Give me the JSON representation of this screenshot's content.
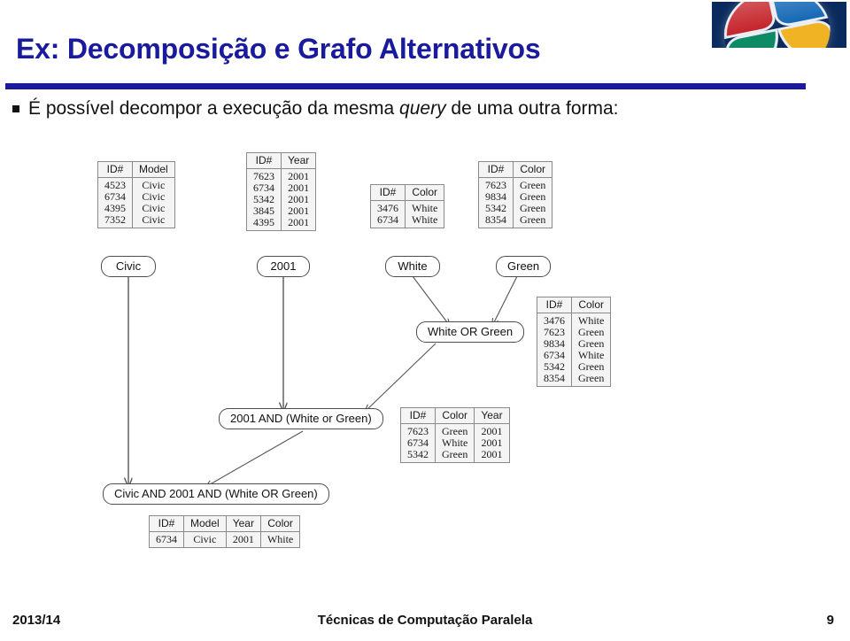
{
  "slide": {
    "title": "Ex: Decomposição e Grafo Alternativos",
    "bullet_text_before": "É possível decompor a execução da mesma ",
    "bullet_emphasis": "query",
    "bullet_text_after": " de uma outra forma:",
    "logo_name": "windows-flag-logo",
    "accent_color": "#1a1a9c"
  },
  "diagram": {
    "tables": [
      {
        "name": "table-model-civic",
        "headers": [
          "ID#",
          "Model"
        ],
        "rows": [
          [
            "4523",
            "Civic"
          ],
          [
            "6734",
            "Civic"
          ],
          [
            "4395",
            "Civic"
          ],
          [
            "7352",
            "Civic"
          ]
        ]
      },
      {
        "name": "table-year-2001",
        "headers": [
          "ID#",
          "Year"
        ],
        "rows": [
          [
            "7623",
            "2001"
          ],
          [
            "6734",
            "2001"
          ],
          [
            "5342",
            "2001"
          ],
          [
            "3845",
            "2001"
          ],
          [
            "4395",
            "2001"
          ]
        ]
      },
      {
        "name": "table-color-white",
        "headers": [
          "ID#",
          "Color"
        ],
        "rows": [
          [
            "3476",
            "White"
          ],
          [
            "6734",
            "White"
          ]
        ]
      },
      {
        "name": "table-color-green",
        "headers": [
          "ID#",
          "Color"
        ],
        "rows": [
          [
            "7623",
            "Green"
          ],
          [
            "9834",
            "Green"
          ],
          [
            "5342",
            "Green"
          ],
          [
            "8354",
            "Green"
          ]
        ]
      },
      {
        "name": "table-white-or-green",
        "headers": [
          "ID#",
          "Color"
        ],
        "rows": [
          [
            "3476",
            "White"
          ],
          [
            "7623",
            "Green"
          ],
          [
            "9834",
            "Green"
          ],
          [
            "6734",
            "White"
          ],
          [
            "5342",
            "Green"
          ],
          [
            "8354",
            "Green"
          ]
        ]
      },
      {
        "name": "table-2001-and-white-or-green",
        "headers": [
          "ID#",
          "Color",
          "Year"
        ],
        "rows": [
          [
            "7623",
            "Green",
            "2001"
          ],
          [
            "6734",
            "White",
            "2001"
          ],
          [
            "5342",
            "Green",
            "2001"
          ]
        ]
      },
      {
        "name": "table-final-result",
        "headers": [
          "ID#",
          "Model",
          "Year",
          "Color"
        ],
        "rows": [
          [
            "6734",
            "Civic",
            "2001",
            "White"
          ]
        ]
      }
    ],
    "nodes": [
      {
        "name": "node-civic",
        "label": "Civic"
      },
      {
        "name": "node-2001",
        "label": "2001"
      },
      {
        "name": "node-white",
        "label": "White"
      },
      {
        "name": "node-green",
        "label": "Green"
      },
      {
        "name": "node-white-or-green",
        "label": "White OR Green"
      },
      {
        "name": "node-2001-and-white-or-green",
        "label": "2001 AND (White or Green)"
      },
      {
        "name": "node-final",
        "label": "Civic AND 2001 AND (White OR Green)"
      }
    ]
  },
  "footer": {
    "left": "2013/14",
    "center": "Técnicas de Computação Paralela",
    "right": "9"
  }
}
